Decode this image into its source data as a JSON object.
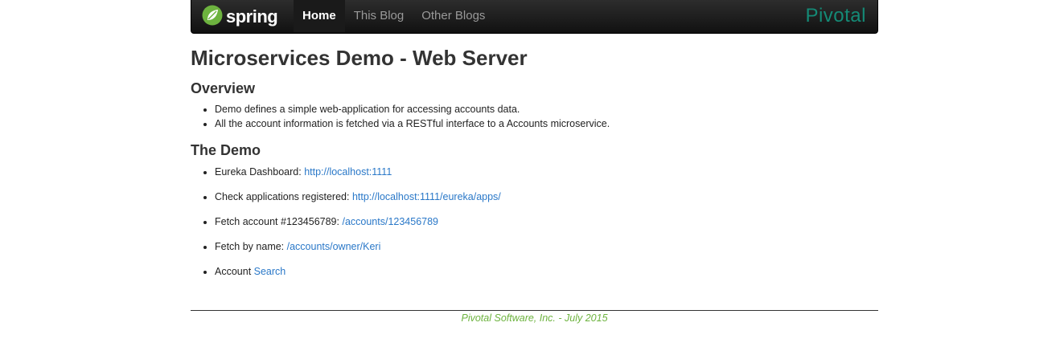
{
  "nav": {
    "brand": "spring",
    "items": [
      {
        "label": "Home",
        "active": true
      },
      {
        "label": "This Blog",
        "active": false
      },
      {
        "label": "Other Blogs",
        "active": false
      }
    ],
    "partner": "Pivotal"
  },
  "colors": {
    "accent_green": "#6db33f",
    "link_blue": "#2a78c8",
    "pivotal_teal": "#148a76"
  },
  "page": {
    "title": "Microservices Demo - Web Server",
    "overview": {
      "heading": "Overview",
      "items": [
        "Demo defines a simple web-application for accessing accounts data.",
        "All the account information is fetched via a RESTful interface to a Accounts microservice."
      ]
    },
    "demo": {
      "heading": "The Demo",
      "items": [
        {
          "text": "Eureka Dashboard: ",
          "link": "http://localhost:1111"
        },
        {
          "text": "Check applications registered: ",
          "link": "http://localhost:1111/eureka/apps/"
        },
        {
          "text": "Fetch account #123456789: ",
          "link": "/accounts/123456789"
        },
        {
          "text": "Fetch by name: ",
          "link": "/accounts/owner/Keri"
        },
        {
          "text": "Account ",
          "link": "Search"
        }
      ]
    }
  },
  "footer": {
    "text": "Pivotal Software, Inc. - July 2015"
  }
}
